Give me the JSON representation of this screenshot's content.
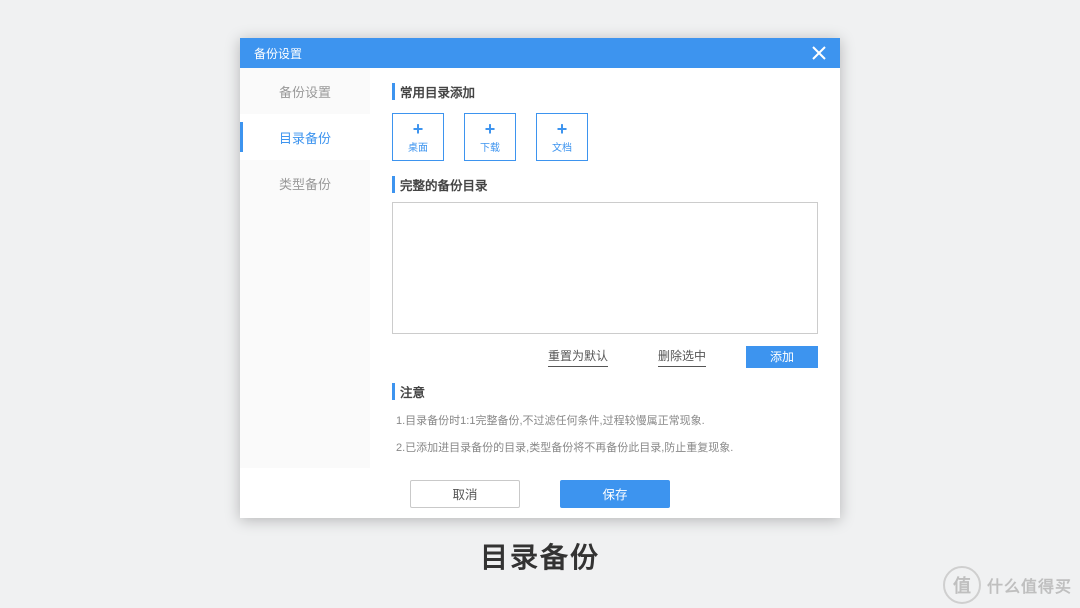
{
  "titlebar": {
    "title": "备份设置"
  },
  "sidebar": {
    "items": [
      {
        "label": "备份设置"
      },
      {
        "label": "目录备份"
      },
      {
        "label": "类型备份"
      }
    ],
    "active_index": 1
  },
  "main": {
    "quick_section_title": "常用目录添加",
    "quick_tiles": [
      {
        "label": "桌面"
      },
      {
        "label": "下载"
      },
      {
        "label": "文档"
      }
    ],
    "full_section_title": "完整的备份目录",
    "actions": {
      "reset_default": "重置为默认",
      "delete_selected": "删除选中",
      "add": "添加"
    },
    "notice_title": "注意",
    "notice_lines": [
      "1.目录备份时1:1完整备份,不过滤任何条件,过程较慢属正常现象.",
      "2.已添加进目录备份的目录,类型备份将不再备份此目录,防止重复现象."
    ]
  },
  "footer": {
    "cancel": "取消",
    "save": "保存"
  },
  "caption": "目录备份",
  "watermark": {
    "badge": "值",
    "text": "什么值得买"
  }
}
